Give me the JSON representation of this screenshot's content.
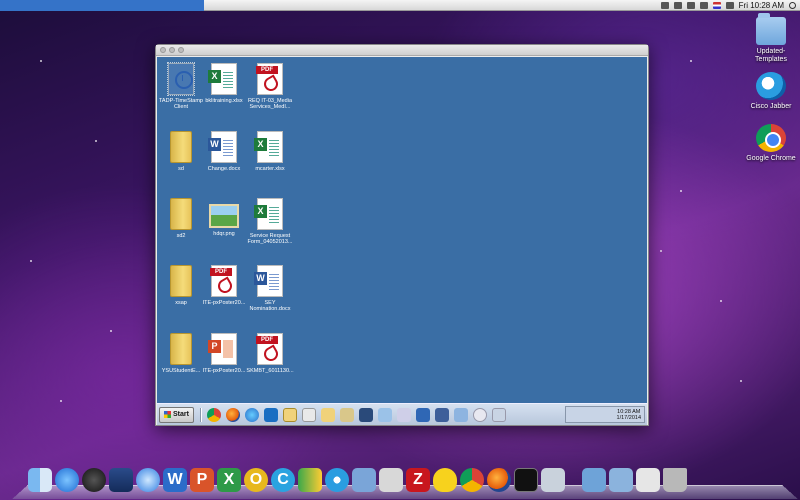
{
  "menubar": {
    "clock": "Fri 10:28 AM"
  },
  "desktop_icons": [
    {
      "label": "Updated-\nTemplates",
      "icon": "folder-icon"
    },
    {
      "label": "Cisco Jabber",
      "icon": "cisco-jabber-icon"
    },
    {
      "label": "Google Chrome",
      "icon": "google-chrome-icon"
    }
  ],
  "vm_desktop": {
    "icons": [
      {
        "label": "TADP-TimeStamp Client",
        "type": "shortcut"
      },
      {
        "label": "bklitraining.xlsx",
        "type": "xls"
      },
      {
        "label": "REQ IT-03_Media Services_MedI...",
        "type": "pdf"
      },
      {
        "label": "sd",
        "type": "folder"
      },
      {
        "label": "Change.docx",
        "type": "word"
      },
      {
        "label": "mcarter.xlsx",
        "type": "xls"
      },
      {
        "label": "sd2",
        "type": "folder"
      },
      {
        "label": "hdqr.png",
        "type": "png"
      },
      {
        "label": "Service Request Form_04052013...",
        "type": "xls"
      },
      {
        "label": "xsap",
        "type": "folder"
      },
      {
        "label": "ITE-pxPoster20...",
        "type": "pdf"
      },
      {
        "label": "SEY Nomination.docx",
        "type": "word"
      },
      {
        "label": "YSUStudentE...",
        "type": "folder"
      },
      {
        "label": "ITE-pxPoster20...",
        "type": "ppt"
      },
      {
        "label": "SKMBT_6011130...",
        "type": "pdf"
      }
    ],
    "taskbar": {
      "start_label": "Start",
      "clock_time": "10:28 AM",
      "clock_date": "1/17/2014"
    }
  },
  "dock": {
    "items": [
      "finder-icon",
      "app-store-icon",
      "dashboard-icon",
      "mission-control-icon",
      "safari-icon",
      "word-icon",
      "powerpoint-icon",
      "excel-icon",
      "outlook-icon",
      "communicator-icon",
      "messenger-icon",
      "jabber-icon",
      "preview-icon",
      "remote-desktop-icon",
      "filezilla-icon",
      "cyberduck-icon",
      "chrome-icon",
      "firefox-icon",
      "terminal-icon",
      "image-capture-icon",
      "applications-folder-icon",
      "documents-folder-icon",
      "downloads-icon",
      "trash-icon"
    ]
  },
  "colors": {
    "win_desktop": "#3a6ea5",
    "menu_accent": "#3573c8"
  }
}
